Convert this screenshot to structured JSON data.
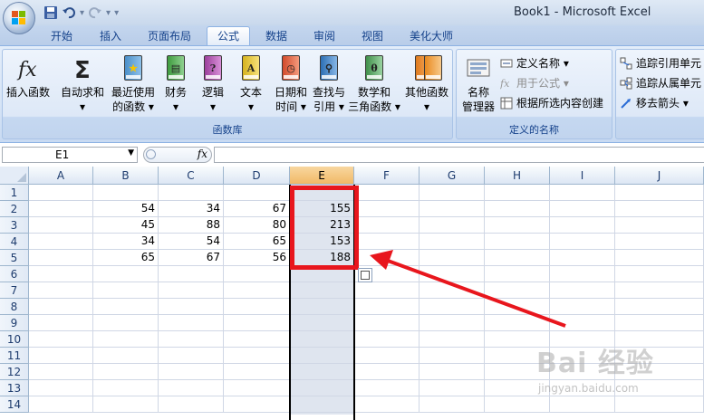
{
  "window": {
    "title": "Book1 - Microsoft Excel"
  },
  "tabs": [
    {
      "label": "开始",
      "active": false
    },
    {
      "label": "插入",
      "active": false
    },
    {
      "label": "页面布局",
      "active": false
    },
    {
      "label": "公式",
      "active": true
    },
    {
      "label": "数据",
      "active": false
    },
    {
      "label": "审阅",
      "active": false
    },
    {
      "label": "视图",
      "active": false
    },
    {
      "label": "美化大师",
      "active": false
    }
  ],
  "ribbon": {
    "function_library": {
      "label": "函数库",
      "buttons": [
        {
          "line1": "插入函数",
          "line2": "",
          "icon": "fx-icon"
        },
        {
          "line1": "自动求和",
          "line2": "▾",
          "icon": "sigma-icon"
        },
        {
          "line1": "最近使用",
          "line2": "的函数 ▾",
          "icon": "star-book-icon"
        },
        {
          "line1": "财务",
          "line2": "▾",
          "icon": "finance-book-icon"
        },
        {
          "line1": "逻辑",
          "line2": "▾",
          "icon": "logic-book-icon"
        },
        {
          "line1": "文本",
          "line2": "▾",
          "icon": "text-book-icon"
        },
        {
          "line1": "日期和",
          "line2": "时间 ▾",
          "icon": "datetime-book-icon"
        },
        {
          "line1": "查找与",
          "line2": "引用 ▾",
          "icon": "lookup-book-icon"
        },
        {
          "line1": "数学和",
          "line2": "三角函数 ▾",
          "icon": "math-book-icon"
        },
        {
          "line1": "其他函数",
          "line2": "▾",
          "icon": "more-books-icon"
        }
      ]
    },
    "defined_names": {
      "label": "定义的名称",
      "name_manager": {
        "line1": "名称",
        "line2": "管理器"
      },
      "define_name": "定义名称 ▾",
      "use_in_formula": "用于公式 ▾",
      "create_from_selection": "根据所选内容创建"
    },
    "formula_auditing": {
      "trace_precedents": "追踪引用单元",
      "trace_dependents": "追踪从属单元",
      "remove_arrows": "移去箭头 ▾"
    }
  },
  "formula_bar": {
    "name_box": "E1",
    "fx": "fx",
    "formula": ""
  },
  "sheet": {
    "columns": [
      "A",
      "B",
      "C",
      "D",
      "E",
      "F",
      "G",
      "H",
      "I",
      "J"
    ],
    "selected_column": "E",
    "rows": [
      "1",
      "2",
      "3",
      "4",
      "5",
      "6",
      "7",
      "8",
      "9",
      "10",
      "11",
      "12",
      "13",
      "14"
    ],
    "data": [
      {
        "row": "2",
        "B": "54",
        "C": "34",
        "D": "67",
        "E": "155"
      },
      {
        "row": "3",
        "B": "45",
        "C": "88",
        "D": "80",
        "E": "213"
      },
      {
        "row": "4",
        "B": "34",
        "C": "54",
        "D": "65",
        "E": "153"
      },
      {
        "row": "5",
        "B": "65",
        "C": "67",
        "D": "56",
        "E": "188"
      }
    ]
  },
  "annotation": {
    "highlight_color": "#e8161d"
  },
  "watermark": {
    "line1": "Bai 经验",
    "line2": "jingyan.baidu.com"
  }
}
